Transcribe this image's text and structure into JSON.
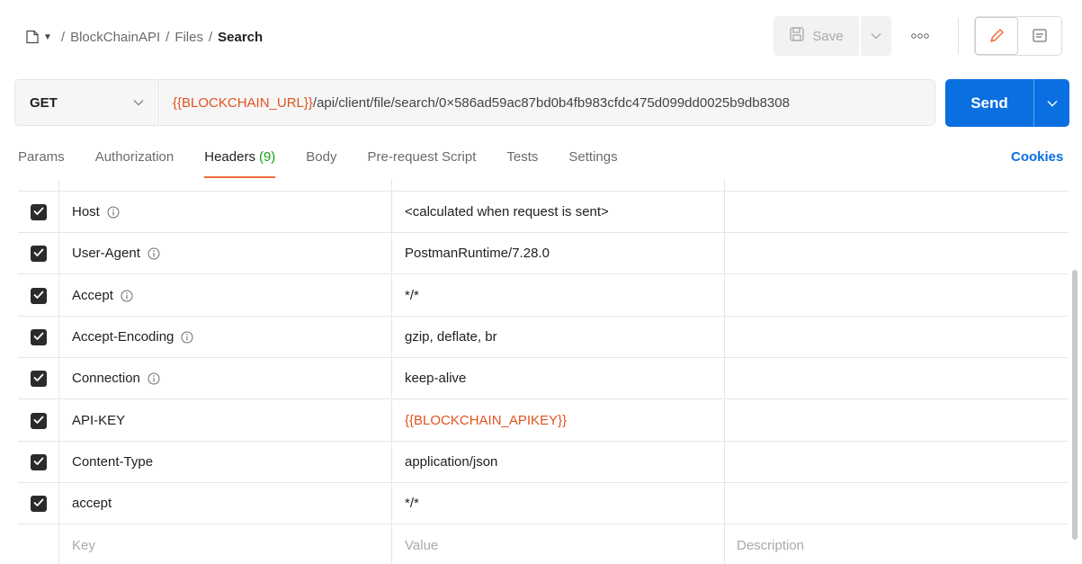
{
  "breadcrumb": {
    "items": [
      "BlockChainAPI",
      "Files"
    ],
    "current": "Search",
    "separator": "/"
  },
  "toolbar": {
    "save_label": "Save"
  },
  "request": {
    "method": "GET",
    "url_variable": "{{BLOCKCHAIN_URL}}",
    "url_path": "/api/client/file/search/0×586ad59ac87bd0b4fb983cfdc475d099dd0025b9db8308",
    "send_label": "Send"
  },
  "tabs": [
    {
      "label": "Params"
    },
    {
      "label": "Authorization"
    },
    {
      "label": "Headers",
      "count": "(9)"
    },
    {
      "label": "Body"
    },
    {
      "label": "Pre-request Script"
    },
    {
      "label": "Tests"
    },
    {
      "label": "Settings"
    }
  ],
  "cookies_label": "Cookies",
  "headers": [
    {
      "key": "Host",
      "value": "<calculated when request is sent>",
      "info": true,
      "checked": true
    },
    {
      "key": "User-Agent",
      "value": "PostmanRuntime/7.28.0",
      "info": true,
      "checked": true
    },
    {
      "key": "Accept",
      "value": "*/*",
      "info": true,
      "checked": true
    },
    {
      "key": "Accept-Encoding",
      "value": "gzip, deflate, br",
      "info": true,
      "checked": true
    },
    {
      "key": "Connection",
      "value": "keep-alive",
      "info": true,
      "checked": true
    },
    {
      "key": "API-KEY",
      "value": "{{BLOCKCHAIN_APIKEY}}",
      "info": false,
      "checked": true,
      "value_is_variable": true
    },
    {
      "key": "Content-Type",
      "value": "application/json",
      "info": false,
      "checked": true
    },
    {
      "key": "accept",
      "value": "*/*",
      "info": false,
      "checked": true
    }
  ],
  "new_row": {
    "key_placeholder": "Key",
    "value_placeholder": "Value",
    "description_placeholder": "Description"
  },
  "colors": {
    "accent_blue": "#0a6fe0",
    "variable_orange": "#e05320",
    "tab_underline": "#f26b3a",
    "count_green": "#14a014"
  }
}
